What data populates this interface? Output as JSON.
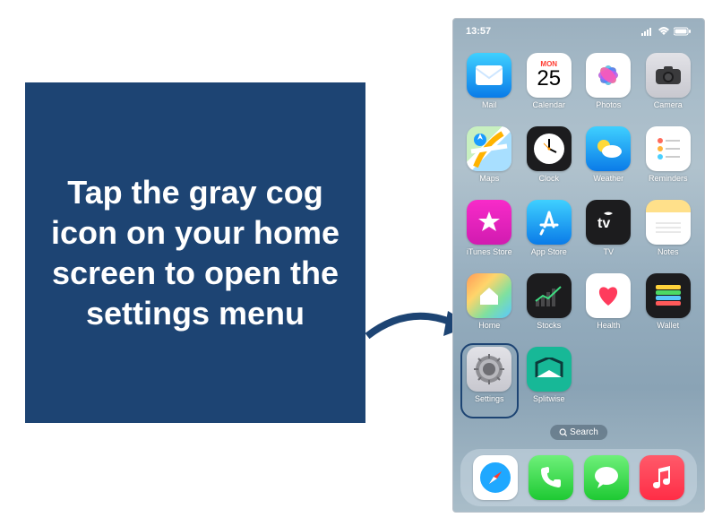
{
  "callout": {
    "text": "Tap the gray cog icon on your home screen to open the settings menu"
  },
  "status": {
    "time": "13:57"
  },
  "calendar": {
    "weekday": "MON",
    "day": "25"
  },
  "apps": {
    "row1": [
      {
        "label": "Mail"
      },
      {
        "label": "Calendar"
      },
      {
        "label": "Photos"
      },
      {
        "label": "Camera"
      }
    ],
    "row2": [
      {
        "label": "Maps"
      },
      {
        "label": "Clock"
      },
      {
        "label": "Weather"
      },
      {
        "label": "Reminders"
      }
    ],
    "row3": [
      {
        "label": "iTunes Store"
      },
      {
        "label": "App Store"
      },
      {
        "label": "TV"
      },
      {
        "label": "Notes"
      }
    ],
    "row4": [
      {
        "label": "Home"
      },
      {
        "label": "Stocks"
      },
      {
        "label": "Health"
      },
      {
        "label": "Wallet"
      }
    ],
    "row5": [
      {
        "label": "Settings"
      },
      {
        "label": "Splitwise"
      }
    ]
  },
  "search": {
    "label": "Search"
  },
  "dock": [
    "Safari",
    "Phone",
    "Messages",
    "Music"
  ]
}
